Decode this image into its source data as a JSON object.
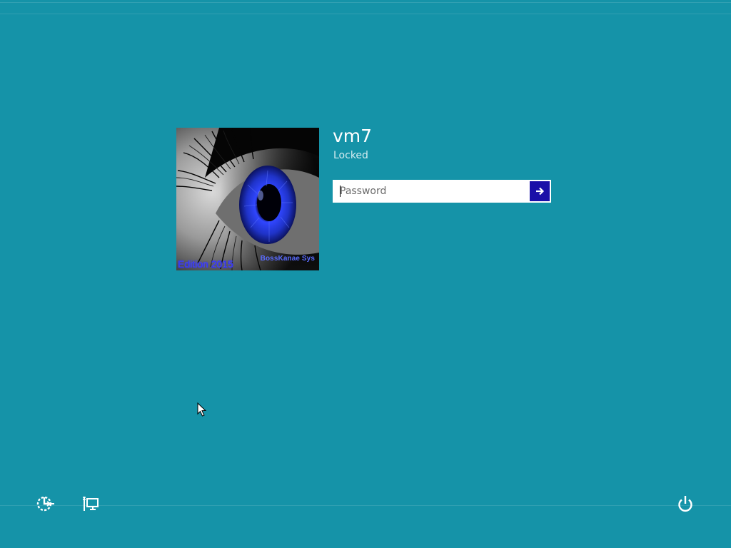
{
  "user": {
    "name": "vm7",
    "status": "Locked"
  },
  "avatar": {
    "edition_text": "Edition 2015",
    "brand_text": "BossKanae Sys"
  },
  "password": {
    "placeholder": "Password",
    "value": "",
    "submit_icon": "arrow-right-icon"
  },
  "bottom_bar": {
    "left_icons": [
      "ease-of-access-icon",
      "network-icon"
    ],
    "right_icons": [
      "power-icon"
    ]
  },
  "colors": {
    "background": "#1593a8",
    "submit_button": "#1a0fa8",
    "text": "#ffffff"
  }
}
